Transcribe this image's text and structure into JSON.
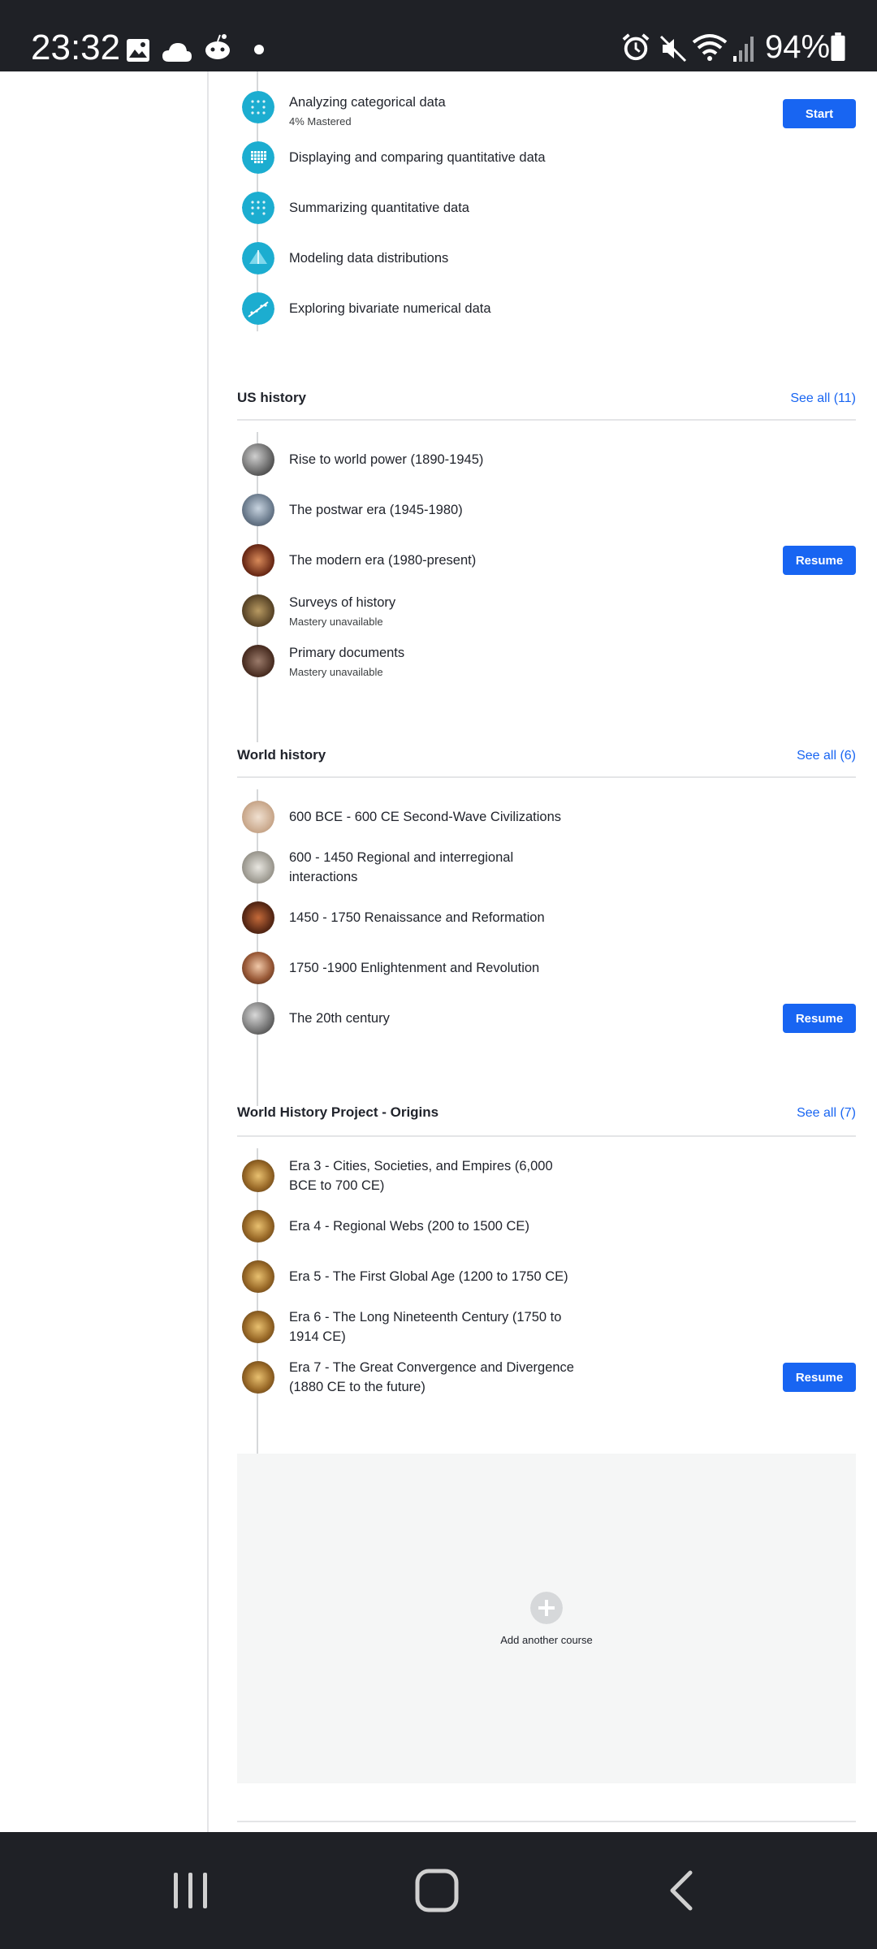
{
  "status_bar": {
    "time": "23:32",
    "battery": "94%",
    "icons": [
      "gallery-icon",
      "cloud-icon",
      "reddit-icon",
      "dot-icon",
      "alarm-icon",
      "mute-icon",
      "wifi-icon",
      "signal-icon",
      "battery-icon"
    ]
  },
  "first_course": {
    "units": [
      {
        "title": "Analyzing categorical data",
        "subtitle": "4% Mastered",
        "button": "Start",
        "icon": "stats-dots-icon"
      },
      {
        "title": "Displaying and comparing quantitative data",
        "icon": "stats-grid-icon"
      },
      {
        "title": "Summarizing quantitative data",
        "icon": "stats-dots-icon"
      },
      {
        "title": "Modeling data distributions",
        "icon": "stats-triangle-icon"
      },
      {
        "title": "Exploring bivariate numerical data",
        "icon": "stats-scatter-icon"
      }
    ]
  },
  "us_history": {
    "title": "US history",
    "see_all": "See all (11)",
    "units": [
      {
        "title": "Rise to world power (1890-1945)"
      },
      {
        "title": "The postwar era (1945-1980)"
      },
      {
        "title": "The modern era (1980-present)",
        "button": "Resume"
      },
      {
        "title": "Surveys of history",
        "subtitle": "Mastery unavailable"
      },
      {
        "title": "Primary documents",
        "subtitle": "Mastery unavailable"
      }
    ]
  },
  "world_history": {
    "title": "World history",
    "see_all": "See all (6)",
    "units": [
      {
        "title": "600 BCE - 600 CE Second-Wave Civilizations"
      },
      {
        "title": "600 - 1450 Regional and interregional interactions"
      },
      {
        "title": "1450 - 1750 Renaissance and Reformation"
      },
      {
        "title": "1750 -1900 Enlightenment and Revolution"
      },
      {
        "title": "The 20th century",
        "button": "Resume"
      }
    ]
  },
  "whp_origins": {
    "title": "World History Project - Origins",
    "see_all": "See all (7)",
    "units": [
      {
        "title": "Era 3 - Cities, Societies, and Empires (6,000 BCE to 700 CE)"
      },
      {
        "title": "Era 4 - Regional Webs (200 to 1500 CE)"
      },
      {
        "title": "Era 5 - The First Global Age (1200 to 1750 CE)"
      },
      {
        "title": "Era 6 - The Long Nineteenth Century (1750 to 1914 CE)"
      },
      {
        "title": "Era 7 - The Great Convergence and Divergence (1880 CE to the future)",
        "button": "Resume"
      }
    ]
  },
  "add_course": {
    "label": "Add another course"
  },
  "nav": {
    "icons": [
      "recent-apps-icon",
      "home-icon",
      "back-icon"
    ]
  },
  "colors": {
    "accent": "#1865f2",
    "stats_icon": "#1cadd0",
    "bar": "#1f2126"
  }
}
